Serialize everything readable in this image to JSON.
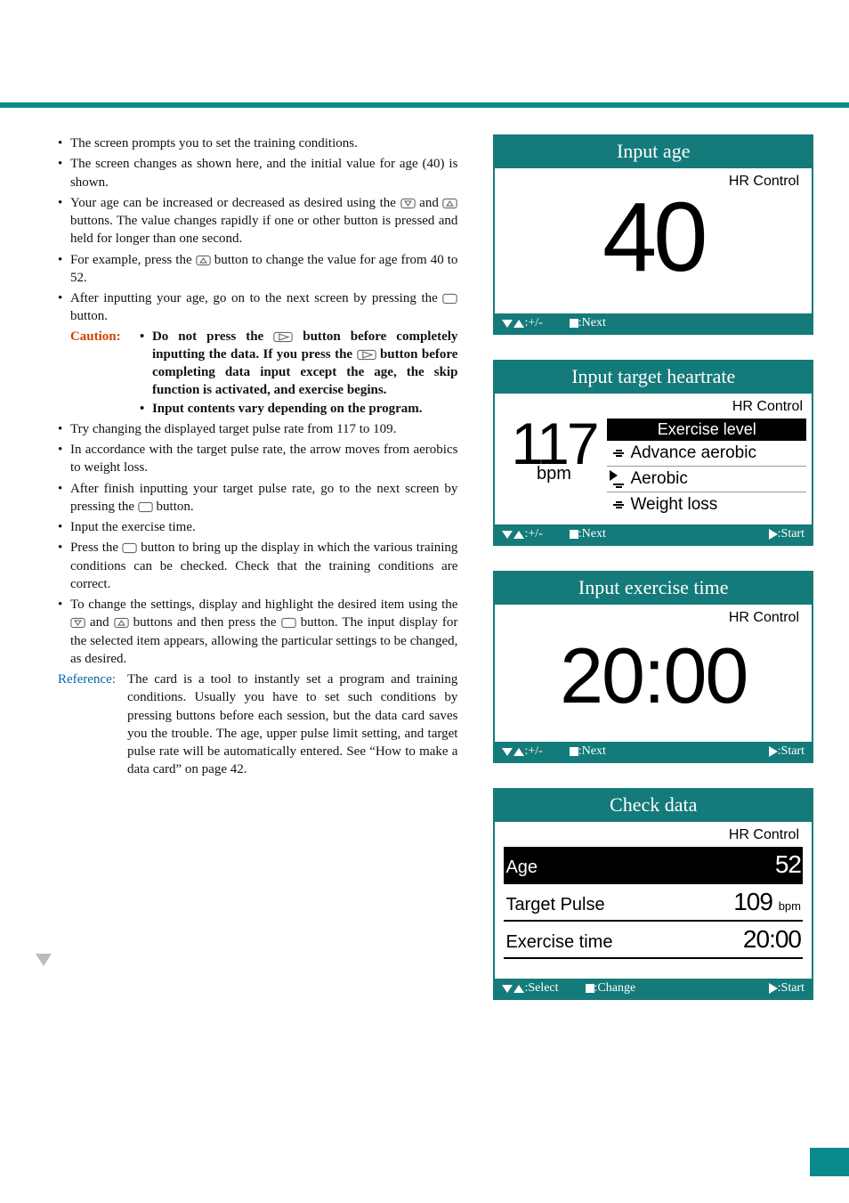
{
  "bullets": {
    "b1": "The screen prompts you to set the training conditions.",
    "b2": "The screen changes as shown here, and the initial value for age (40) is shown.",
    "b3a": "Your age can be increased or decreased as desired using the ",
    "b3b": " and ",
    "b3c": " buttons. The value changes rapidly if one or other button is pressed and held for longer than one second.",
    "b4a": "For example, press the ",
    "b4b": " button to change the value for age from 40 to 52.",
    "b5a": "After inputting your age, go on to the next screen by pressing the ",
    "b5b": " button.",
    "b6": "Try changing the displayed target pulse rate from 117 to 109.",
    "b7": "In accordance with the target pulse rate, the arrow moves from aerobics to weight loss.",
    "b8a": "After finish inputting your target pulse rate, go to the next screen by pressing the ",
    "b8b": " button.",
    "b9": "Input the exercise time.",
    "b10a": "Press the ",
    "b10b": " button to bring up the display in which the various training conditions can be checked. Check that the training conditions are correct.",
    "b11a": "To change the settings, display and highlight the desired item using the ",
    "b11b": " and ",
    "b11c": " buttons and then press the ",
    "b11d": " button. The input display for the selected item appears, allowing the particular settings to be changed, as desired."
  },
  "caution": {
    "label": "Caution:",
    "c1a": "Do not press the ",
    "c1b": " button before completely inputting the data. If you press the ",
    "c1c": " button before completing  data input except the age, the skip function is activated, and exercise begins.",
    "c2": "Input contents vary depending on the program."
  },
  "reference": {
    "label": "Reference:",
    "text": "The card is a tool to instantly set a program and training conditions. Usually you have to set such conditions by pressing buttons before each session, but the data card saves you the trouble. The age, upper pulse limit setting, and target pulse rate will be automatically entered. See “How to make a data card” on page 42."
  },
  "panel1": {
    "title": "Input age",
    "hr": "HR Control",
    "value": "40",
    "foot1": ":+/-",
    "foot2": ":Next"
  },
  "panel2": {
    "title": "Input target heartrate",
    "hr": "HR Control",
    "value": "117",
    "unit": "bpm",
    "level_hdr": "Exercise level",
    "row1": "Advance aerobic",
    "row2": "Aerobic",
    "row3": "Weight loss",
    "foot1": ":+/-",
    "foot2": ":Next",
    "foot3": ":Start"
  },
  "panel3": {
    "title": "Input exercise time",
    "hr": "HR Control",
    "value": "20:00",
    "foot1": ":+/-",
    "foot2": ":Next",
    "foot3": ":Start"
  },
  "panel4": {
    "title": "Check data",
    "hr": "HR Control",
    "r1l": "Age",
    "r1v": "52",
    "r2l": "Target Pulse",
    "r2v": "109",
    "r2u": "bpm",
    "r3l": "Exercise time",
    "r3v": "20:00",
    "foot1": ":Select",
    "foot2": ":Change",
    "foot3": ":Start"
  }
}
